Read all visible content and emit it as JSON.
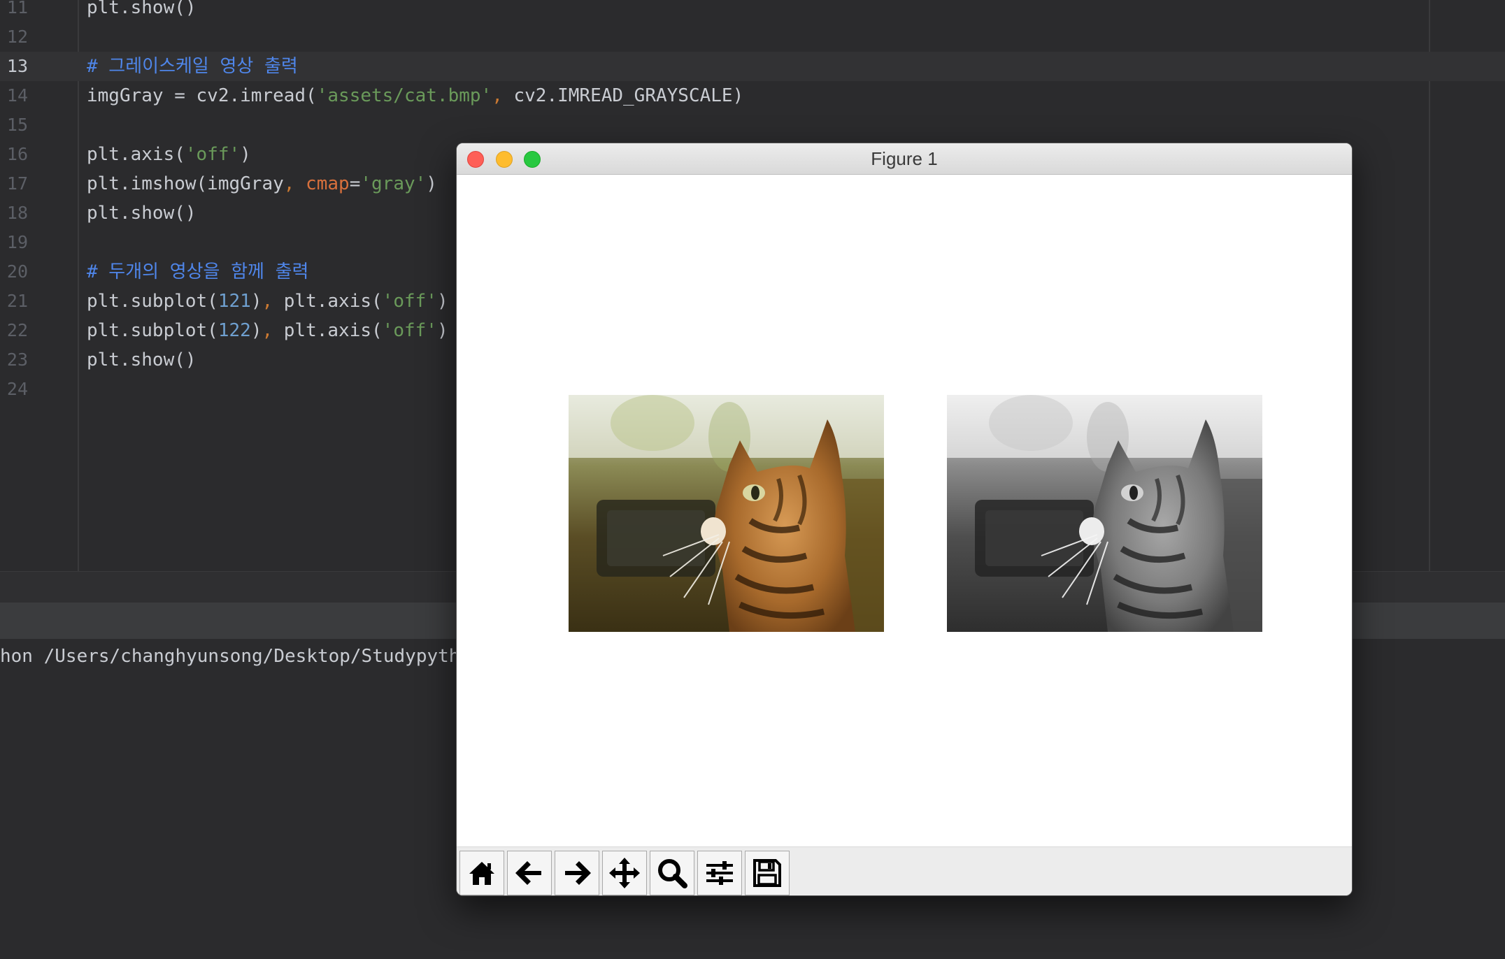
{
  "editor": {
    "lines": [
      {
        "num": "11",
        "code": "plt.show()"
      },
      {
        "num": "12",
        "code": ""
      },
      {
        "num": "13",
        "comment": "# 그레이스케일 영상 출력",
        "current": true
      },
      {
        "num": "14",
        "parts": [
          "imgGray = cv2.imread(",
          "'assets/cat.bmp'",
          ", ",
          "cv2.IMREAD_GRAYSCALE)"
        ]
      },
      {
        "num": "15",
        "code": ""
      },
      {
        "num": "16",
        "parts": [
          "plt.axis(",
          "'off'",
          ")"
        ]
      },
      {
        "num": "17",
        "parts": [
          "plt.imshow(imgGray",
          ", ",
          "cmap",
          "=",
          "'gray'",
          ")"
        ]
      },
      {
        "num": "18",
        "code": "plt.show()"
      },
      {
        "num": "19",
        "code": ""
      },
      {
        "num": "20",
        "comment": "# 두개의 영상을 함께 출력"
      },
      {
        "num": "21",
        "parts": [
          "plt.subplot(",
          "121",
          ")",
          ", ",
          "plt.axis(",
          "'off'",
          ")"
        ]
      },
      {
        "num": "22",
        "parts": [
          "plt.subplot(",
          "122",
          ")",
          ", ",
          "plt.axis(",
          "'off'",
          ")"
        ]
      },
      {
        "num": "23",
        "code": "plt.show()"
      },
      {
        "num": "24",
        "code": ""
      }
    ]
  },
  "console": {
    "text": "hon /Users/changhyunsong/Desktop/Studypyth"
  },
  "figure": {
    "title": "Figure 1",
    "toolbar": [
      {
        "name": "home-icon",
        "label": "Home"
      },
      {
        "name": "back-arrow-icon",
        "label": "Back"
      },
      {
        "name": "forward-arrow-icon",
        "label": "Forward"
      },
      {
        "name": "pan-move-icon",
        "label": "Pan"
      },
      {
        "name": "zoom-magnifier-icon",
        "label": "Zoom"
      },
      {
        "name": "configure-subplots-icon",
        "label": "Subplots"
      },
      {
        "name": "save-floppy-icon",
        "label": "Save"
      }
    ]
  },
  "colors": {
    "comment": "#4f86ea",
    "string": "#6a9a5a",
    "number": "#6fa0d0",
    "param": "#d8703c",
    "close": "#fe5f57",
    "minimize": "#febc2e",
    "maximize": "#28c840"
  }
}
